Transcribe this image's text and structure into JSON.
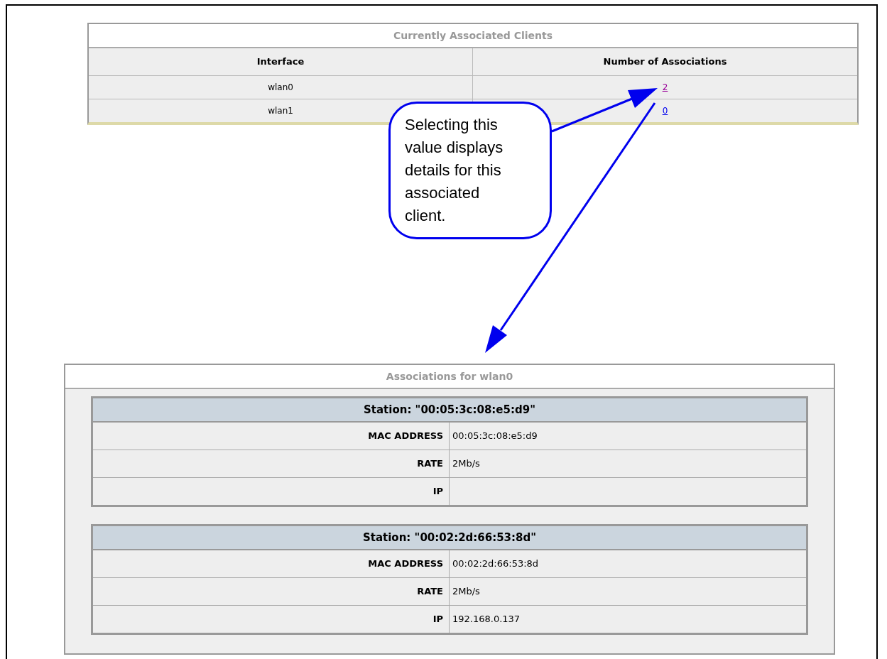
{
  "clients_table": {
    "title": "Currently Associated Clients",
    "columns": [
      "Interface",
      "Number of Associations"
    ],
    "rows": [
      {
        "interface": "wlan0",
        "count": "2",
        "visited": true
      },
      {
        "interface": "wlan1",
        "count": "0",
        "visited": false
      }
    ]
  },
  "callout": {
    "text": "Selecting this value displays details for this associated client."
  },
  "associations": {
    "title": "Associations for wlan0",
    "stations": [
      {
        "title": "Station: \"00:05:3c:08:e5:d9\"",
        "fields": [
          {
            "label": "MAC ADDRESS",
            "value": "00:05:3c:08:e5:d9"
          },
          {
            "label": "RATE",
            "value": "2Mb/s"
          },
          {
            "label": "IP"
          }
        ]
      },
      {
        "title": "Station: \"00:02:2d:66:53:8d\"",
        "fields": [
          {
            "label": "MAC ADDRESS",
            "value": "00:02:2d:66:53:8d"
          },
          {
            "label": "RATE",
            "value": "2Mb/s"
          },
          {
            "label": "IP",
            "value": "192.168.0.137"
          }
        ]
      }
    ]
  }
}
